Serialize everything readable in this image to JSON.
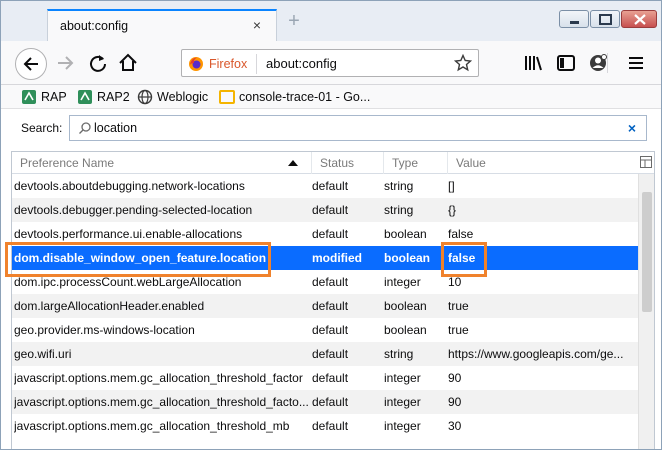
{
  "tab": {
    "title": "about:config",
    "close": "×",
    "new_tab": "+"
  },
  "urlbar": {
    "identity_label": "Firefox",
    "url": "about:config"
  },
  "bookmarks": [
    {
      "label": "RAP"
    },
    {
      "label": "RAP2"
    },
    {
      "label": "Weblogic"
    },
    {
      "label": "console-trace-01 - Go..."
    }
  ],
  "search": {
    "label": "Search:",
    "value": "location",
    "clear": "×"
  },
  "table": {
    "headers": {
      "name": "Preference Name",
      "status": "Status",
      "type": "Type",
      "value": "Value"
    },
    "rows": [
      {
        "name": "devtools.aboutdebugging.network-locations",
        "status": "default",
        "type": "string",
        "value": "[]"
      },
      {
        "name": "devtools.debugger.pending-selected-location",
        "status": "default",
        "type": "string",
        "value": "{}"
      },
      {
        "name": "devtools.performance.ui.enable-allocations",
        "status": "default",
        "type": "boolean",
        "value": "false"
      },
      {
        "name": "dom.disable_window_open_feature.location",
        "status": "modified",
        "type": "boolean",
        "value": "false"
      },
      {
        "name": "dom.ipc.processCount.webLargeAllocation",
        "status": "default",
        "type": "integer",
        "value": "10"
      },
      {
        "name": "dom.largeAllocationHeader.enabled",
        "status": "default",
        "type": "boolean",
        "value": "true"
      },
      {
        "name": "geo.provider.ms-windows-location",
        "status": "default",
        "type": "boolean",
        "value": "true"
      },
      {
        "name": "geo.wifi.uri",
        "status": "default",
        "type": "string",
        "value": "https://www.googleapis.com/ge..."
      },
      {
        "name": "javascript.options.mem.gc_allocation_threshold_factor",
        "status": "default",
        "type": "integer",
        "value": "90"
      },
      {
        "name": "javascript.options.mem.gc_allocation_threshold_facto...",
        "status": "default",
        "type": "integer",
        "value": "90"
      },
      {
        "name": "javascript.options.mem.gc_allocation_threshold_mb",
        "status": "default",
        "type": "integer",
        "value": "30"
      }
    ]
  },
  "colors": {
    "accent": "#0a84ff",
    "selection": "#0a6cff",
    "highlight": "#f0822c",
    "firefox_orange": "#d9572b"
  },
  "icons": [
    "back-arrow-icon",
    "forward-arrow-icon",
    "reload-icon",
    "home-icon",
    "firefox-logo-icon",
    "star-icon",
    "library-icon",
    "sidebar-icon",
    "account-icon",
    "hamburger-menu-icon",
    "globe-icon",
    "search-icon",
    "sort-ascending-icon",
    "column-picker-icon"
  ]
}
